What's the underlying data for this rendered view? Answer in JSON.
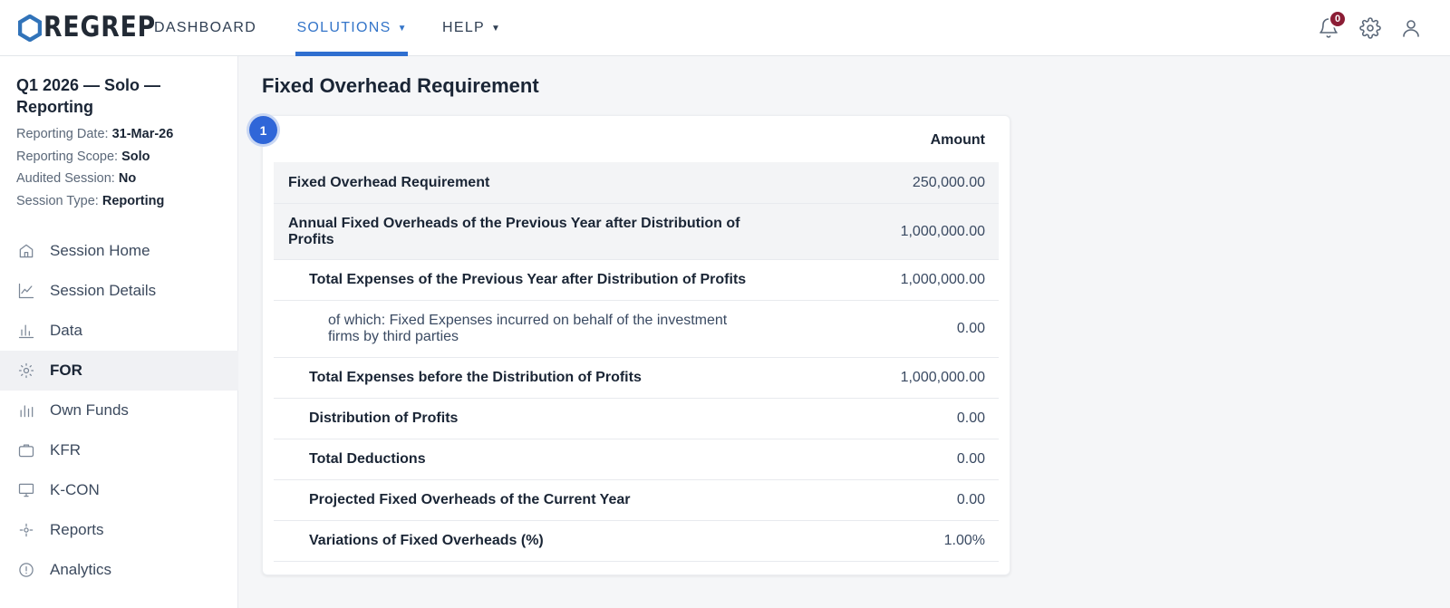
{
  "header": {
    "logo_text": "REGREP",
    "nav": {
      "dashboard": "DASHBOARD",
      "solutions": "SOLUTIONS",
      "help": "HELP"
    },
    "notifications_count": "0"
  },
  "sidebar": {
    "session_title": "Q1 2026 — Solo — Reporting",
    "meta": {
      "reporting_date_label": "Reporting Date:",
      "reporting_date_value": "31-Mar-26",
      "reporting_scope_label": "Reporting Scope:",
      "reporting_scope_value": "Solo",
      "audited_session_label": "Audited Session:",
      "audited_session_value": "No",
      "session_type_label": "Session Type:",
      "session_type_value": "Reporting"
    },
    "items": [
      {
        "label": "Session Home",
        "icon": "home-icon"
      },
      {
        "label": "Session Details",
        "icon": "line-chart-icon"
      },
      {
        "label": "Data",
        "icon": "bar-chart-icon"
      },
      {
        "label": "FOR",
        "icon": "sun-icon",
        "active": true
      },
      {
        "label": "Own Funds",
        "icon": "bars-icon"
      },
      {
        "label": "KFR",
        "icon": "briefcase-icon"
      },
      {
        "label": "K-CON",
        "icon": "monitor-icon"
      },
      {
        "label": "Reports",
        "icon": "target-icon"
      },
      {
        "label": "Analytics",
        "icon": "alert-circle-icon"
      }
    ]
  },
  "main": {
    "page_title": "Fixed Overhead Requirement",
    "step_number": "1",
    "amount_header": "Amount",
    "rows": [
      {
        "label": "Fixed Overhead Requirement",
        "value": "250,000.00"
      },
      {
        "label": "Annual Fixed Overheads of the Previous Year after Distribution of Profits",
        "value": "1,000,000.00"
      },
      {
        "label": "Total Expenses of the Previous Year after Distribution of Profits",
        "value": "1,000,000.00"
      },
      {
        "label": "of which: Fixed Expenses incurred on behalf of the investment firms by third parties",
        "value": "0.00"
      },
      {
        "label": "Total Expenses before the Distribution of Profits",
        "value": "1,000,000.00"
      },
      {
        "label": "Distribution of Profits",
        "value": "0.00"
      },
      {
        "label": "Total Deductions",
        "value": "0.00"
      },
      {
        "label": "Projected Fixed Overheads of the Current Year",
        "value": "0.00"
      },
      {
        "label": "Variations of Fixed Overheads (%)",
        "value": "1.00%"
      }
    ]
  },
  "colors": {
    "accent": "#2f6fd0",
    "badge": "#8b1d35",
    "text_dark": "#1a2535"
  }
}
